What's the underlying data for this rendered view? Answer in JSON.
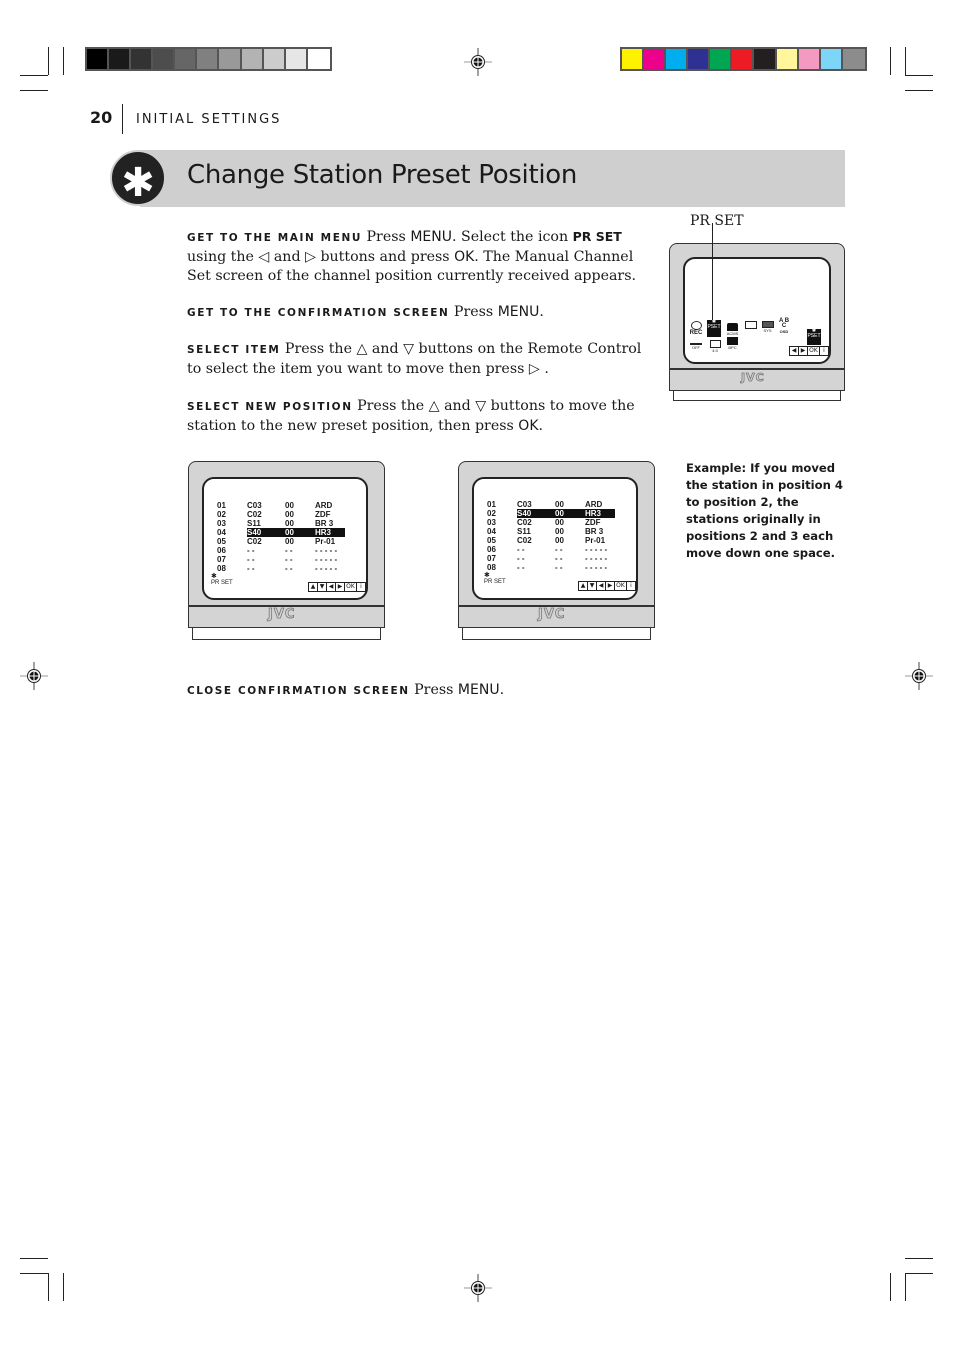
{
  "header": {
    "page_number": "20",
    "section": "INITIAL SETTINGS",
    "title": "Change Station Preset Position",
    "badge_icon": "asterisk-icon",
    "badge_glyph": "✱"
  },
  "color_bars": {
    "grayscale": [
      "#000000",
      "#1a1a1a",
      "#333333",
      "#4d4d4d",
      "#666666",
      "#808080",
      "#999999",
      "#b3b3b3",
      "#cccccc",
      "#e6e6e6",
      "#ffffff"
    ],
    "colors": [
      "#fff200",
      "#ec008c",
      "#00aeef",
      "#2e3192",
      "#00a651",
      "#ed1c24",
      "#231f20",
      "#fff799",
      "#f49ac1",
      "#7dd6f7",
      "#8c8c8c"
    ]
  },
  "steps": [
    {
      "label": "GET TO THE MAIN MENU",
      "parts": [
        {
          "t": "text",
          "v": " Press "
        },
        {
          "t": "key",
          "v": "MENU"
        },
        {
          "t": "text",
          "v": ". Select the icon "
        },
        {
          "t": "keyb",
          "v": "PR SET"
        },
        {
          "t": "text",
          "v": " using the ◁ and ▷ buttons and press "
        },
        {
          "t": "key",
          "v": "OK"
        },
        {
          "t": "text",
          "v": ". The Manual Channel Set screen of the channel position currently received appears."
        }
      ]
    },
    {
      "label": "GET TO THE CONFIRMATION SCREEN",
      "parts": [
        {
          "t": "text",
          "v": " Press "
        },
        {
          "t": "key",
          "v": "MENU"
        },
        {
          "t": "text",
          "v": "."
        }
      ]
    },
    {
      "label": "SELECT ITEM",
      "parts": [
        {
          "t": "text",
          "v": " Press the △ and ▽ buttons on the Remote Control to select the item you want to move then press ▷ ."
        }
      ]
    },
    {
      "label": "SELECT NEW POSITION",
      "parts": [
        {
          "t": "text",
          "v": " Press the △ and ▽ buttons to move the station to the new preset position, then press "
        },
        {
          "t": "key",
          "v": "OK"
        },
        {
          "t": "text",
          "v": "."
        }
      ]
    },
    {
      "label": "CLOSE CONFIRMATION SCREEN",
      "parts": [
        {
          "t": "text",
          "v": " Press "
        },
        {
          "t": "key",
          "v": "MENU"
        },
        {
          "t": "text",
          "v": "."
        }
      ]
    }
  ],
  "main_menu_tv": {
    "callout_label": "PR SET",
    "brand": "JVC",
    "icons_row1": [
      "REC",
      "PR SET",
      "ACMS",
      "LANG",
      "SYSTEM",
      "A B C OSD"
    ],
    "icons_row2": [
      "OFF",
      "16:9 4:3",
      "BPC"
    ],
    "selected_icon": "PR SET",
    "nav_keys": [
      "◀",
      "▶",
      "OK",
      "i"
    ]
  },
  "tv_before": {
    "brand": "JVC",
    "selected_row": 3,
    "rows": [
      [
        "01",
        "C03",
        "00",
        "ARD"
      ],
      [
        "02",
        "C02",
        "00",
        "ZDF"
      ],
      [
        "03",
        "S11",
        "00",
        "BR 3"
      ],
      [
        "04",
        "S40",
        "00",
        "HR3"
      ],
      [
        "05",
        "C02",
        "00",
        "Pr-01"
      ],
      [
        "06",
        "- -",
        "- -",
        "- - - - -"
      ],
      [
        "07",
        "- -",
        "- -",
        "- - - - -"
      ],
      [
        "08",
        "- -",
        "- -",
        "- - - - -"
      ]
    ],
    "footer_label": "PR SET",
    "nav_keys": [
      "▲",
      "▼",
      "◀",
      "▶",
      "OK",
      "i"
    ]
  },
  "tv_after": {
    "brand": "JVC",
    "selected_row": 1,
    "rows": [
      [
        "01",
        "C03",
        "00",
        "ARD"
      ],
      [
        "02",
        "S40",
        "00",
        "HR3"
      ],
      [
        "03",
        "C02",
        "00",
        "ZDF"
      ],
      [
        "04",
        "S11",
        "00",
        "BR 3"
      ],
      [
        "05",
        "C02",
        "00",
        "Pr-01"
      ],
      [
        "06",
        "- -",
        "- -",
        "- - - - -"
      ],
      [
        "07",
        "- -",
        "- -",
        "- - - - -"
      ],
      [
        "08",
        "- -",
        "- -",
        "- - - - -"
      ]
    ],
    "footer_label": "PR SET",
    "nav_keys": [
      "▲",
      "▼",
      "◀",
      "▶",
      "OK",
      "i"
    ]
  },
  "example_note": "Example: If you moved the station in position 4 to position 2, the stations originally in positions 2 and 3 each move down one space."
}
